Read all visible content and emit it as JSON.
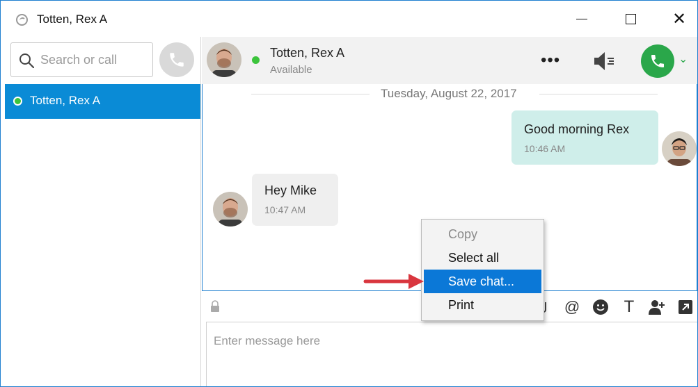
{
  "window": {
    "title": "Totten, Rex A",
    "minimize_label": "—",
    "maximize_label": "",
    "close_label": "✕"
  },
  "sidebar": {
    "search_placeholder": "Search or call",
    "contacts": [
      {
        "name": "Totten, Rex A",
        "status_color": "#3cc43c",
        "selected": true
      }
    ]
  },
  "header": {
    "contact_name": "Totten, Rex A",
    "presence": "Available",
    "more_label": "•••",
    "chevron_label": "⌄"
  },
  "conversation": {
    "date": "Tuesday, August 22, 2017",
    "messages": [
      {
        "direction": "outgoing",
        "text": "Good morning Rex",
        "time": "10:46 AM"
      },
      {
        "direction": "incoming",
        "text": "Hey Mike",
        "time": "10:47 AM"
      }
    ]
  },
  "composer": {
    "placeholder": "Enter message here",
    "tools": [
      "mention-icon",
      "emoji-icon",
      "text-format-icon",
      "add-participant-icon",
      "popout-icon"
    ],
    "mention_glyph": "@",
    "text_glyph": "T"
  },
  "context_menu": {
    "items": [
      {
        "label": "Copy",
        "enabled": false,
        "selected": false
      },
      {
        "label": "Select all",
        "enabled": true,
        "selected": false
      },
      {
        "label": "Save chat...",
        "enabled": true,
        "selected": true
      },
      {
        "label": "Print",
        "enabled": true,
        "selected": false
      }
    ]
  },
  "colors": {
    "accent": "#0a8bd6",
    "menu_highlight": "#0b78d7",
    "call_green": "#2aa74a",
    "available_green": "#3cc43c",
    "outgoing_bubble": "#cfeeea",
    "incoming_bubble": "#efefef",
    "arrow_red": "#d9363e"
  }
}
